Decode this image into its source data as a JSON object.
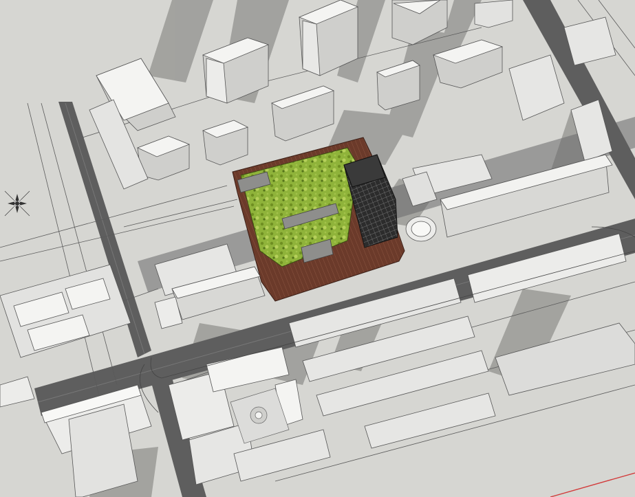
{
  "scene": {
    "view": "aerial-3d-urban-model",
    "colors": {
      "ground": "#d6d6d2",
      "road": "#5f5f5f",
      "shadow": "#8f8f8c",
      "building_top": "#f4f4f2",
      "building_side": "#cfcfcc",
      "green_roof": "#8fb33a",
      "deck": "#6b3a2a",
      "glass_tower": "#2a2a2a",
      "red_axis": "#d23a3a"
    },
    "icons": [
      "north-compass-icon"
    ]
  }
}
